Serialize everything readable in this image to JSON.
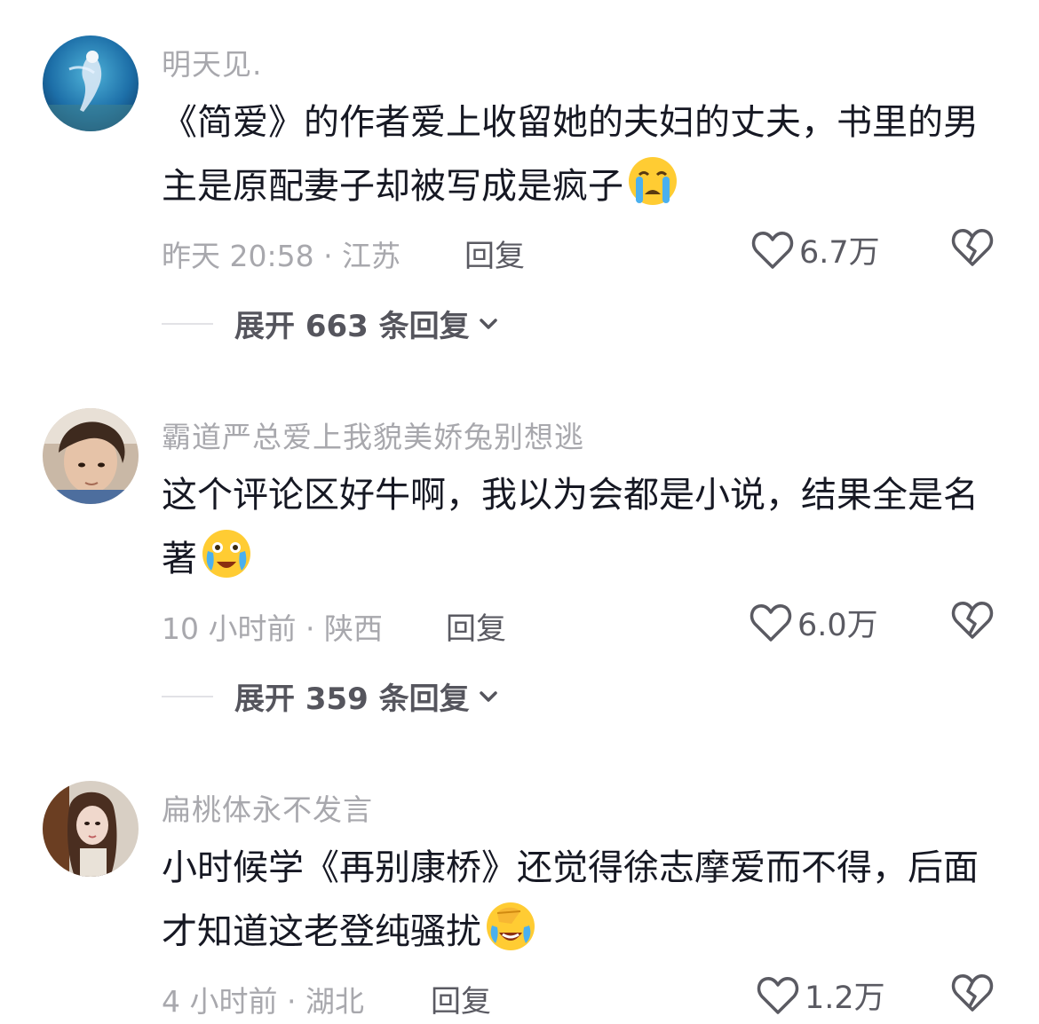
{
  "comments": [
    {
      "username": "明天见.",
      "text": "《简爱》的作者爱上收留她的夫妇的丈夫，书里的男主是原配妻子却被写成是疯子",
      "emoji": "loudly-crying-face",
      "meta": "昨天 20:58 · 江苏",
      "reply_label": "回复",
      "likes": "6.7万",
      "expand_label": "展开 663 条回复"
    },
    {
      "username": "霸道严总爱上我貌美娇兔别想逃",
      "text": "这个评论区好牛啊，我以为会都是小说，结果全是名著",
      "emoji": "crying-face-with-open-mouth",
      "meta": "10 小时前 · 陕西",
      "reply_label": "回复",
      "likes": "6.0万",
      "expand_label": "展开 359 条回复"
    },
    {
      "username": "扁桃体永不发言",
      "text": "小时候学《再别康桥》还觉得徐志摩爱而不得，后面才知道这老登纯骚扰",
      "emoji": "face-palm-crying",
      "meta": "4 小时前 · 湖北",
      "reply_label": "回复",
      "likes": "1.2万"
    }
  ],
  "icons": {
    "like": "heart-outline-icon",
    "dislike": "broken-heart-icon",
    "expand": "chevron-down-icon"
  },
  "colors": {
    "background": "#ffffff",
    "text_primary": "#161823",
    "text_secondary": "#a8a8ad",
    "action": "#5a5a62",
    "emoji": "#ffcc33"
  }
}
